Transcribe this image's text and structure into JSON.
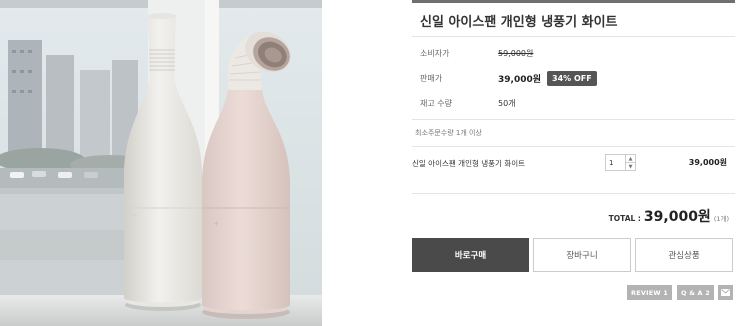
{
  "product": {
    "title": "신일 아이스팬 개인형 냉풍기 화이트"
  },
  "pricing": {
    "consumer_label": "소비자가",
    "consumer_price": "59,000원",
    "sale_label": "판매가",
    "sale_price": "39,000원",
    "discount_badge": "34% OFF",
    "stock_label": "재고 수량",
    "stock_value": "50개"
  },
  "min_order_text": "최소주문수량 1개 이상",
  "option_row": {
    "name": "신일 아이스팬 개인형 냉풍기 화이트",
    "quantity": "1",
    "price": "39,000원"
  },
  "total": {
    "label": "TOTAL :",
    "amount": "39,000원",
    "count": "(1개)"
  },
  "actions": {
    "buy_now": "바로구매",
    "cart": "장바구니",
    "wishlist": "관심상품"
  },
  "sub_actions": {
    "review": "REVIEW 1",
    "qa": "Q & A 2"
  },
  "icons": {
    "qty_up": "caret-up-icon",
    "qty_down": "caret-down-icon",
    "mail": "mail-icon"
  },
  "colors": {
    "buy_button": "#4a4a4a",
    "discount_badge": "#555555",
    "sub_buttons": "#b3b3b3",
    "top_rule": "#6f6f6f"
  }
}
